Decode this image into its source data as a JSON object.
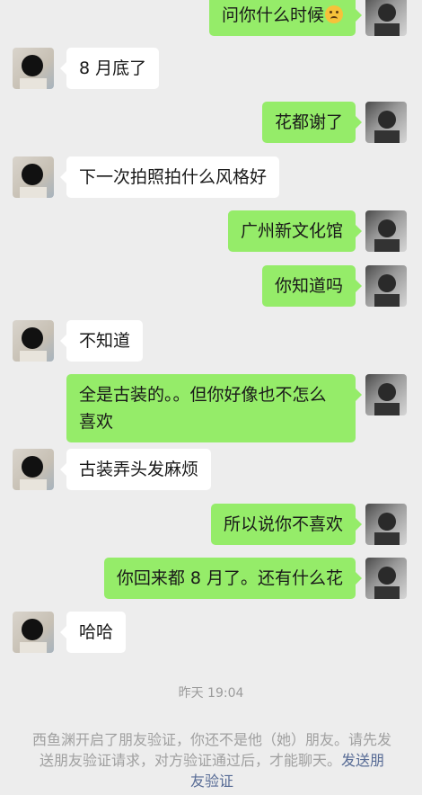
{
  "messages": [
    {
      "side": "right",
      "text": "问你什么时候",
      "emoji": "frowning-emoji"
    },
    {
      "side": "left",
      "text": "8 月底了"
    },
    {
      "side": "right",
      "text": "花都谢了"
    },
    {
      "side": "left",
      "text": "下一次拍照拍什么风格好"
    },
    {
      "side": "right",
      "text": "广州新文化馆"
    },
    {
      "side": "right",
      "text": "你知道吗"
    },
    {
      "side": "left",
      "text": "不知道"
    },
    {
      "side": "right",
      "text": "全是古装的。。但你好像也不怎么喜欢"
    },
    {
      "side": "left",
      "text": "古装弄头发麻烦"
    },
    {
      "side": "right",
      "text": "所以说你不喜欢"
    },
    {
      "side": "right",
      "text": "你回来都 8 月了。还有什么花"
    },
    {
      "side": "left",
      "text": "哈哈"
    }
  ],
  "timestamp": "昨天 19:04",
  "system_notice": {
    "text": "西鱼渊开启了朋友验证，你还不是他（她）朋友。请先发送朋友验证请求，对方验证通过后，才能聊天。",
    "link": "发送朋友验证"
  },
  "colors": {
    "background": "#ededed",
    "my_bubble": "#95ec69",
    "their_bubble": "#ffffff",
    "link": "#576b95"
  }
}
